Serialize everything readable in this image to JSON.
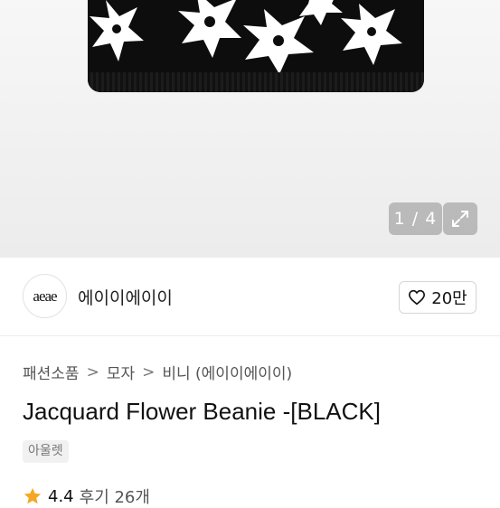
{
  "gallery": {
    "counter": "1 / 4",
    "expand_icon": "expand-icon"
  },
  "seller": {
    "avatar_text": "aeae",
    "name": "에이이에이이"
  },
  "like": {
    "icon": "heart-icon",
    "count": "20만"
  },
  "breadcrumb": {
    "items": [
      "패션소품",
      "모자",
      "비니 (에이이에이이)"
    ]
  },
  "product": {
    "title": "Jacquard Flower Beanie -[BLACK]",
    "tag": "아울렛"
  },
  "rating": {
    "score": "4.4",
    "review_label": "후기 26개",
    "star_color": "#f5a623"
  }
}
